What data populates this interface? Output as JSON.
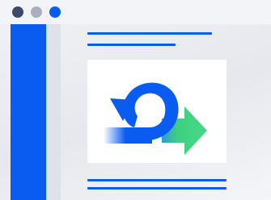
{
  "window": {
    "controls": [
      "close",
      "minimize",
      "zoom"
    ]
  },
  "colors": {
    "accent": "#0a5cf0",
    "dark_dot": "#3b4a68",
    "gray_dot": "#a9afbd",
    "arrow_green": "#3fd07f",
    "background": "#eceef2"
  },
  "illustration": {
    "icon": "loop-arrow-icon",
    "description_icons": [
      "circular-blue-arrow",
      "green-forward-arrow"
    ]
  }
}
